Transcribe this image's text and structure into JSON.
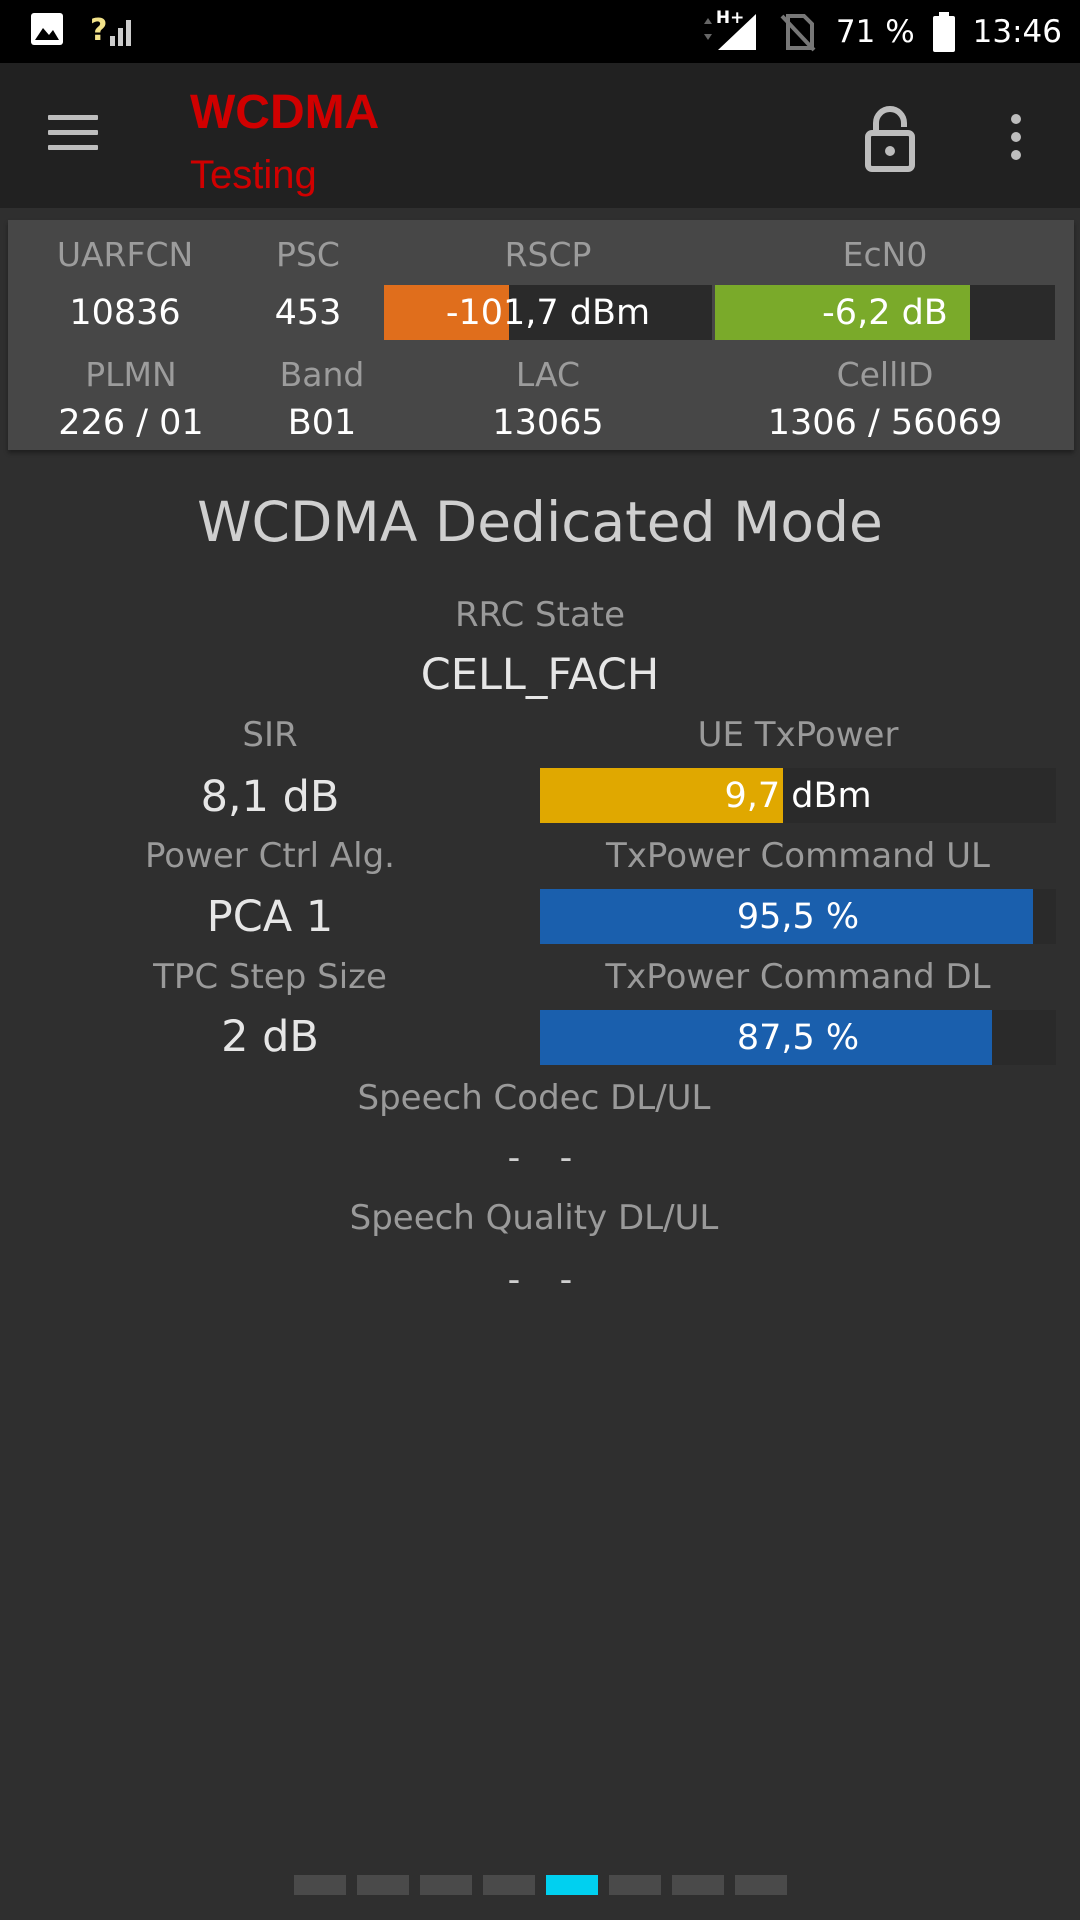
{
  "status_bar": {
    "battery": "71 %",
    "time": "13:46",
    "network_type": "H+",
    "signal_unknown": "?"
  },
  "app_bar": {
    "title": "WCDMA",
    "subtitle": "Testing"
  },
  "cell_info": {
    "uarfcn": {
      "label": "UARFCN",
      "value": "10836"
    },
    "psc": {
      "label": "PSC",
      "value": "453"
    },
    "rscp": {
      "label": "RSCP",
      "value": "-101,7 dBm",
      "fill": 0.38,
      "color": "#e06e1c"
    },
    "ecn0": {
      "label": "EcN0",
      "value": "-6,2 dB",
      "fill": 0.75,
      "color": "#7aaa2a"
    },
    "plmn": {
      "label": "PLMN",
      "value": "226 / 01"
    },
    "band": {
      "label": "Band",
      "value": "B01"
    },
    "lac": {
      "label": "LAC",
      "value": "13065"
    },
    "cellid": {
      "label": "CellID",
      "value": "1306 / 56069"
    }
  },
  "main": {
    "title": "WCDMA Dedicated Mode",
    "rrc_state": {
      "label": "RRC State",
      "value": "CELL_FACH"
    },
    "sir": {
      "label": "SIR",
      "value": "8,1 dB"
    },
    "ue_txpower": {
      "label": "UE TxPower",
      "value": "9,7 dBm",
      "fill": 0.47,
      "color": "#e0a800"
    },
    "power_ctrl": {
      "label": "Power Ctrl Alg.",
      "value": "PCA 1"
    },
    "txcmd_ul": {
      "label": "TxPower Command UL",
      "value": "95,5 %",
      "fill": 0.955,
      "color": "#1a5fad"
    },
    "tpc_step": {
      "label": "TPC Step Size",
      "value": "2 dB"
    },
    "txcmd_dl": {
      "label": "TxPower Command DL",
      "value": "87,5 %",
      "fill": 0.875,
      "color": "#1a5fad"
    },
    "speech_codec": {
      "label": "Speech Codec DL/UL",
      "dl": "-",
      "ul": "-"
    },
    "speech_quality": {
      "label": "Speech Quality DL/UL",
      "dl": "-",
      "ul": "-"
    }
  },
  "pager": {
    "count": 8,
    "active_index": 4,
    "active_color": "#00d0f0"
  }
}
